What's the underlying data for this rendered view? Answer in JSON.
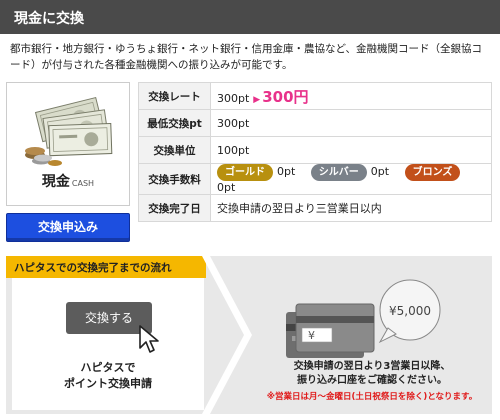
{
  "header": {
    "title": "現金に交換"
  },
  "description": "都市銀行・地方銀行・ゆうちょ銀行・ネット銀行・信用金庫・農協など、金融機関コード（全銀協コード）が付与された各種金融機関への振り込みが可能です。",
  "card": {
    "label_jp": "現金",
    "label_en": "CASH"
  },
  "apply_button": "交換申込み",
  "info": {
    "rate": {
      "key": "交換レート",
      "value": "300pt",
      "arrow": "▶",
      "highlight": "300円"
    },
    "minimum": {
      "key": "最低交換pt",
      "value": "300pt"
    },
    "unit": {
      "key": "交換単位",
      "value": "100pt"
    },
    "fee": {
      "key": "交換手数料",
      "tiers": [
        {
          "label": "ゴールド",
          "value": "0pt",
          "color": "#b8900f"
        },
        {
          "label": "シルバー",
          "value": "0pt",
          "color": "#7a8189"
        },
        {
          "label": "ブロンズ",
          "value": "0pt",
          "color": "#c2501a"
        }
      ]
    },
    "completion": {
      "key": "交換完了日",
      "value": "交換申請の翌日より三営業日以内"
    }
  },
  "flow": {
    "title": "ハピタスでの交換完了までの流れ",
    "step1_button": "交換する",
    "step1_line1": "ハピタスで",
    "step1_line2": "ポイント交換申請",
    "bubble_amount": "¥5,000",
    "step2_line1": "交換申請の翌日より3営業日以降、",
    "step2_line2": "振り込み口座をご確認ください。",
    "step2_note": "※営業日は月～金曜日(土日祝祭日を除く)となります。"
  },
  "colors": {
    "accent_pink": "#e8318a",
    "apply_blue": "#1d4fe0",
    "flow_yellow": "#f5b700",
    "note_red": "#e01a1a"
  }
}
